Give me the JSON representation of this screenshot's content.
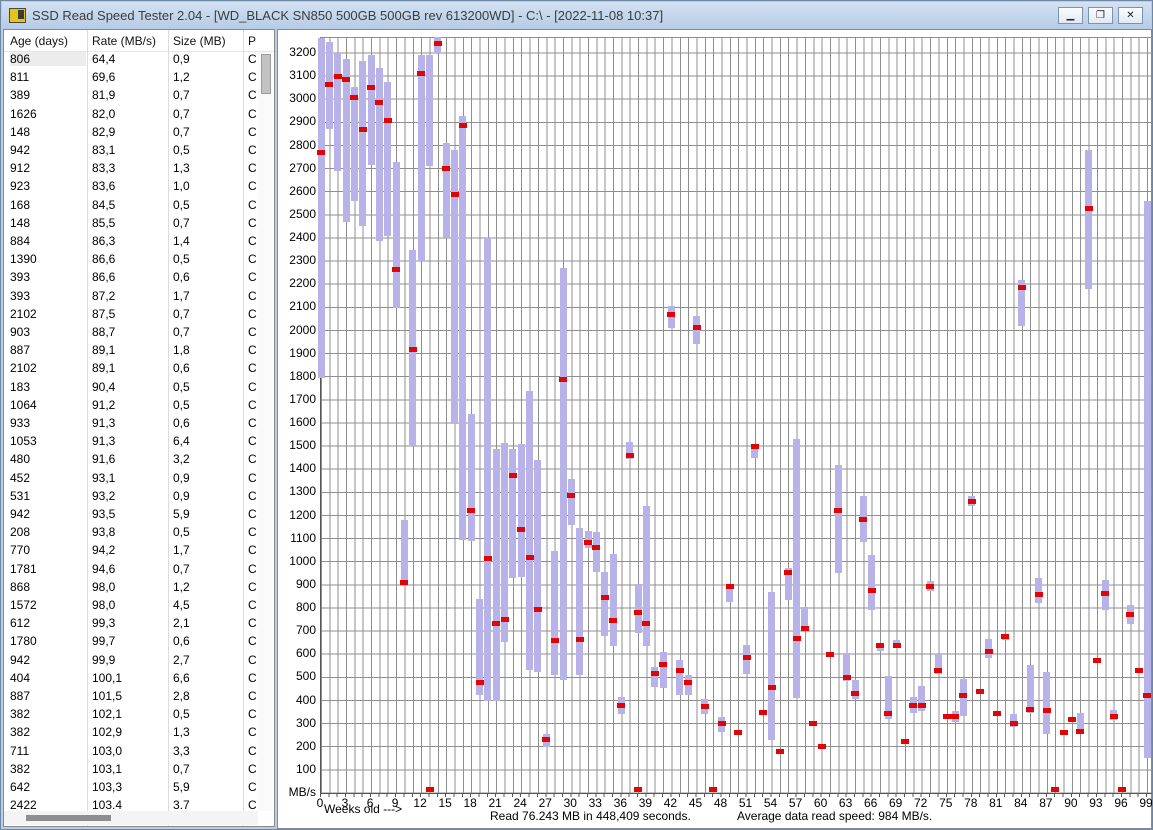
{
  "window": {
    "title": "SSD Read Speed Tester 2.04 - [WD_BLACK SN850 500GB 500GB rev 613200WD] - C:\\ - [2022-11-08 10:37]",
    "controls": {
      "minimize": "▁",
      "maximize": "❐",
      "close": "✕"
    }
  },
  "table": {
    "headers": [
      "Age (days)",
      "Rate (MB/s)",
      "Size (MB)",
      "P"
    ],
    "rows": [
      [
        "806",
        "64,4",
        "0,9",
        "C"
      ],
      [
        "811",
        "69,6",
        "1,2",
        "C"
      ],
      [
        "389",
        "81,9",
        "0,7",
        "C"
      ],
      [
        "1626",
        "82,0",
        "0,7",
        "C"
      ],
      [
        "148",
        "82,9",
        "0,7",
        "C"
      ],
      [
        "942",
        "83,1",
        "0,5",
        "C"
      ],
      [
        "912",
        "83,3",
        "1,3",
        "C"
      ],
      [
        "923",
        "83,6",
        "1,0",
        "C"
      ],
      [
        "168",
        "84,5",
        "0,5",
        "C"
      ],
      [
        "148",
        "85,5",
        "0,7",
        "C"
      ],
      [
        "884",
        "86,3",
        "1,4",
        "C"
      ],
      [
        "1390",
        "86,6",
        "0,5",
        "C"
      ],
      [
        "393",
        "86,6",
        "0,6",
        "C"
      ],
      [
        "393",
        "87,2",
        "1,7",
        "C"
      ],
      [
        "2102",
        "87,5",
        "0,7",
        "C"
      ],
      [
        "903",
        "88,7",
        "0,7",
        "C"
      ],
      [
        "887",
        "89,1",
        "1,8",
        "C"
      ],
      [
        "2102",
        "89,1",
        "0,6",
        "C"
      ],
      [
        "183",
        "90,4",
        "0,5",
        "C"
      ],
      [
        "1064",
        "91,2",
        "0,5",
        "C"
      ],
      [
        "933",
        "91,3",
        "0,6",
        "C"
      ],
      [
        "1053",
        "91,3",
        "6,4",
        "C"
      ],
      [
        "480",
        "91,6",
        "3,2",
        "C"
      ],
      [
        "452",
        "93,1",
        "0,9",
        "C"
      ],
      [
        "531",
        "93,2",
        "0,9",
        "C"
      ],
      [
        "942",
        "93,5",
        "5,9",
        "C"
      ],
      [
        "208",
        "93,8",
        "0,5",
        "C"
      ],
      [
        "770",
        "94,2",
        "1,7",
        "C"
      ],
      [
        "1781",
        "94,6",
        "0,7",
        "C"
      ],
      [
        "868",
        "98,0",
        "1,2",
        "C"
      ],
      [
        "1572",
        "98,0",
        "4,5",
        "C"
      ],
      [
        "612",
        "99,3",
        "2,1",
        "C"
      ],
      [
        "1780",
        "99,7",
        "0,6",
        "C"
      ],
      [
        "942",
        "99,9",
        "2,7",
        "C"
      ],
      [
        "404",
        "100,1",
        "6,6",
        "C"
      ],
      [
        "887",
        "101,5",
        "2,8",
        "C"
      ],
      [
        "382",
        "102,1",
        "0,5",
        "C"
      ],
      [
        "382",
        "102,9",
        "1,3",
        "C"
      ],
      [
        "711",
        "103,0",
        "3,3",
        "C"
      ],
      [
        "382",
        "103,1",
        "0,7",
        "C"
      ],
      [
        "642",
        "103,3",
        "5,9",
        "C"
      ],
      [
        "2422",
        "103.4",
        "3.7",
        "C"
      ]
    ]
  },
  "chart": {
    "y_unit": "MB/s",
    "x_axis_label": "Weeks old --->",
    "status_read": "Read 76.243 MB in 448,409 seconds.",
    "status_avg": "Average data read speed: 984 MB/s.",
    "colors": {
      "bar": "#b7b3e9",
      "mark": "#e00404",
      "grid": "#8f8f8f"
    }
  },
  "chart_data": {
    "type": "bar",
    "subtype": "weekly min-max range bars with red average marks",
    "xlabel": "Weeks old --->",
    "ylabel": "MB/s",
    "xlim": [
      0,
      100
    ],
    "ylim": [
      0,
      3265
    ],
    "grid": true,
    "x_ticks": [
      0,
      3,
      6,
      9,
      12,
      15,
      18,
      21,
      24,
      27,
      30,
      33,
      36,
      39,
      42,
      45,
      48,
      51,
      54,
      57,
      60,
      63,
      66,
      69,
      72,
      75,
      78,
      81,
      84,
      87,
      90,
      93,
      96,
      99
    ],
    "y_ticks": [
      3200,
      3100,
      3000,
      2900,
      2800,
      2700,
      2600,
      2500,
      2400,
      2300,
      2200,
      2100,
      2000,
      1900,
      1800,
      1700,
      1600,
      1500,
      1400,
      1300,
      1200,
      1100,
      1000,
      900,
      800,
      700,
      600,
      500,
      400,
      300,
      200,
      100
    ],
    "series_format": [
      "week",
      "min_MBps",
      "max_MBps",
      "avg_MBps"
    ],
    "series": [
      [
        0,
        1795,
        3265,
        2770
      ],
      [
        1,
        2870,
        3250,
        3065
      ],
      [
        2,
        2690,
        3200,
        3100
      ],
      [
        3,
        2470,
        3175,
        3085
      ],
      [
        4,
        2560,
        3055,
        3010
      ],
      [
        5,
        2450,
        3165,
        2870
      ],
      [
        6,
        2715,
        3190,
        3050
      ],
      [
        7,
        2385,
        3135,
        2985
      ],
      [
        8,
        2410,
        3075,
        2910
      ],
      [
        9,
        2095,
        2730,
        2265
      ],
      [
        10,
        900,
        1180,
        910
      ],
      [
        11,
        1500,
        2350,
        1920
      ],
      [
        12,
        2300,
        3190,
        3110
      ],
      [
        13,
        2710,
        3190,
        null
      ],
      [
        14,
        3200,
        3270,
        3240
      ],
      [
        15,
        2400,
        2810,
        2700
      ],
      [
        16,
        1595,
        2780,
        2590
      ],
      [
        17,
        1095,
        2930,
        2885
      ],
      [
        18,
        1090,
        1640,
        1220
      ],
      [
        19,
        425,
        840,
        480
      ],
      [
        20,
        400,
        2400,
        1015
      ],
      [
        21,
        400,
        1490,
        735
      ],
      [
        22,
        655,
        1515,
        750
      ],
      [
        23,
        930,
        1490,
        1375
      ],
      [
        24,
        935,
        1510,
        1140
      ],
      [
        25,
        530,
        1740,
        1020
      ],
      [
        26,
        525,
        1440,
        795
      ],
      [
        27,
        200,
        255,
        230
      ],
      [
        28,
        510,
        1045,
        660
      ],
      [
        29,
        490,
        2270,
        1790
      ],
      [
        30,
        1160,
        1360,
        1285
      ],
      [
        31,
        510,
        1145,
        665
      ],
      [
        32,
        1058,
        1135,
        1085
      ],
      [
        33,
        955,
        1130,
        1060
      ],
      [
        34,
        680,
        955,
        845
      ],
      [
        35,
        635,
        1035,
        745
      ],
      [
        36,
        340,
        415,
        380
      ],
      [
        37,
        1445,
        1520,
        1460
      ],
      [
        38,
        690,
        905,
        780
      ],
      [
        39,
        635,
        1240,
        735
      ],
      [
        40,
        460,
        545,
        515
      ],
      [
        41,
        455,
        610,
        555
      ],
      [
        42,
        2010,
        2105,
        2070
      ],
      [
        43,
        425,
        575,
        530
      ],
      [
        44,
        425,
        510,
        480
      ],
      [
        45,
        1940,
        2065,
        2015
      ],
      [
        46,
        342,
        405,
        375
      ],
      [
        48,
        265,
        330,
        300
      ],
      [
        49,
        825,
        905,
        895
      ],
      [
        50,
        250,
        270,
        260
      ],
      [
        51,
        515,
        640,
        585
      ],
      [
        52,
        1450,
        1510,
        1500
      ],
      [
        53,
        340,
        360,
        350
      ],
      [
        54,
        230,
        870,
        455
      ],
      [
        55,
        170,
        190,
        180
      ],
      [
        56,
        835,
        975,
        955
      ],
      [
        57,
        410,
        1530,
        670
      ],
      [
        58,
        700,
        805,
        710
      ],
      [
        59,
        290,
        310,
        300
      ],
      [
        60,
        190,
        210,
        200
      ],
      [
        61,
        590,
        610,
        600
      ],
      [
        62,
        950,
        1420,
        1220
      ],
      [
        63,
        485,
        605,
        500
      ],
      [
        64,
        405,
        490,
        430
      ],
      [
        65,
        1085,
        1285,
        1185
      ],
      [
        66,
        790,
        1030,
        875
      ],
      [
        67,
        615,
        650,
        640
      ],
      [
        68,
        320,
        505,
        345
      ],
      [
        69,
        625,
        660,
        640
      ],
      [
        70,
        215,
        235,
        225
      ],
      [
        71,
        345,
        415,
        380
      ],
      [
        72,
        355,
        465,
        380
      ],
      [
        73,
        875,
        915,
        895
      ],
      [
        74,
        515,
        600,
        530
      ],
      [
        75,
        320,
        340,
        330
      ],
      [
        76,
        305,
        355,
        330
      ],
      [
        77,
        335,
        495,
        420
      ],
      [
        78,
        1240,
        1285,
        1260
      ],
      [
        79,
        430,
        450,
        440
      ],
      [
        80,
        585,
        665,
        610
      ],
      [
        81,
        335,
        355,
        345
      ],
      [
        82,
        660,
        685,
        675
      ],
      [
        83,
        285,
        340,
        300
      ],
      [
        84,
        2020,
        2220,
        2185
      ],
      [
        85,
        345,
        555,
        360
      ],
      [
        86,
        820,
        930,
        860
      ],
      [
        87,
        255,
        525,
        358
      ],
      [
        89,
        250,
        270,
        260
      ],
      [
        90,
        310,
        330,
        320
      ],
      [
        91,
        255,
        345,
        265
      ],
      [
        92,
        2180,
        2780,
        2530
      ],
      [
        93,
        565,
        585,
        575
      ],
      [
        94,
        790,
        920,
        865
      ],
      [
        95,
        315,
        360,
        330
      ],
      [
        97,
        730,
        815,
        770
      ],
      [
        98,
        520,
        540,
        530
      ],
      [
        99,
        150,
        2560,
        420
      ]
    ],
    "zero_axis_marks_weeks": [
      13,
      38,
      47,
      88,
      96
    ]
  }
}
